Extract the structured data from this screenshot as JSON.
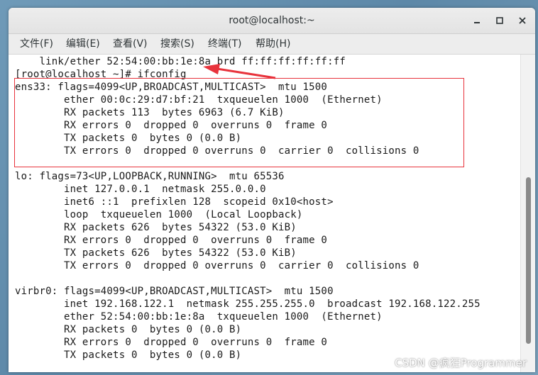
{
  "window": {
    "title": "root@localhost:~"
  },
  "menu": [
    {
      "label": "文件(F)"
    },
    {
      "label": "编辑(E)"
    },
    {
      "label": "查看(V)"
    },
    {
      "label": "搜索(S)"
    },
    {
      "label": "终端(T)"
    },
    {
      "label": "帮助(H)"
    }
  ],
  "terminal": {
    "lines": [
      "    link/ether 52:54:00:bb:1e:8a brd ff:ff:ff:ff:ff:ff",
      "[root@localhost ~]# ifconfig",
      "ens33: flags=4099<UP,BROADCAST,MULTICAST>  mtu 1500",
      "        ether 00:0c:29:d7:bf:21  txqueuelen 1000  (Ethernet)",
      "        RX packets 113  bytes 6963 (6.7 KiB)",
      "        RX errors 0  dropped 0  overruns 0  frame 0",
      "        TX packets 0  bytes 0 (0.0 B)",
      "        TX errors 0  dropped 0 overruns 0  carrier 0  collisions 0",
      "",
      "lo: flags=73<UP,LOOPBACK,RUNNING>  mtu 65536",
      "        inet 127.0.0.1  netmask 255.0.0.0",
      "        inet6 ::1  prefixlen 128  scopeid 0x10<host>",
      "        loop  txqueuelen 1000  (Local Loopback)",
      "        RX packets 626  bytes 54322 (53.0 KiB)",
      "        RX errors 0  dropped 0  overruns 0  frame 0",
      "        TX packets 626  bytes 54322 (53.0 KiB)",
      "        TX errors 0  dropped 0 overruns 0  carrier 0  collisions 0",
      "",
      "virbr0: flags=4099<UP,BROADCAST,MULTICAST>  mtu 1500",
      "        inet 192.168.122.1  netmask 255.255.255.0  broadcast 192.168.122.255",
      "        ether 52:54:00:bb:1e:8a  txqueuelen 1000  (Ethernet)",
      "        RX packets 0  bytes 0 (0.0 B)",
      "        RX errors 0  dropped 0  overruns 0  frame 0",
      "        TX packets 0  bytes 0 (0.0 B)"
    ]
  },
  "watermark": "CSDN @疯狂Programmer",
  "colors": {
    "annotation": "#e8333c",
    "terminal_bg": "#ffffff",
    "terminal_fg": "#1a1a1a"
  },
  "icons": {
    "minimize": "minimize-icon",
    "maximize": "maximize-icon",
    "close": "close-icon"
  }
}
